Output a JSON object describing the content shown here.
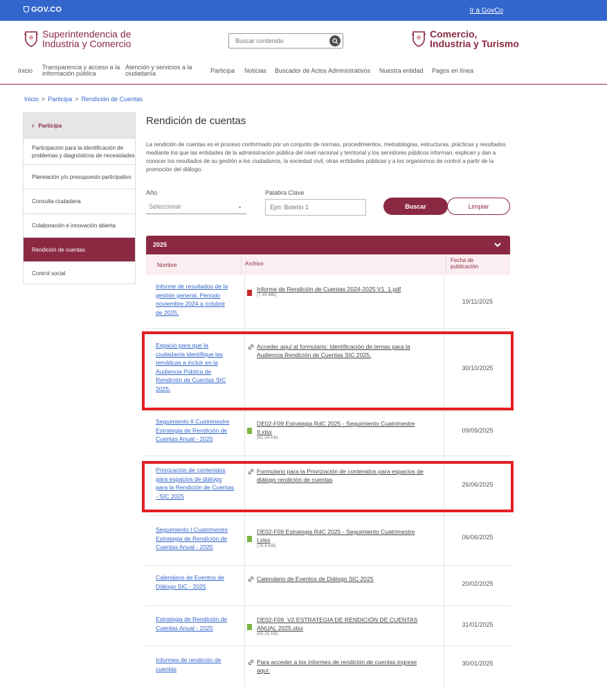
{
  "govbar": {
    "logo": "GOV.CO",
    "link": "Ir a GovCo"
  },
  "header": {
    "brand_left_line1": "Superintendencia de",
    "brand_left_line2": "Industria y Comercio",
    "search_placeholder": "Buscar contenido",
    "brand_right_line1": "Comercio,",
    "brand_right_line2": "Industria y Turismo"
  },
  "nav": {
    "items": [
      {
        "l1": "Inicio",
        "l2": ""
      },
      {
        "l1": "Transparencia y acceso a la",
        "l2": "información pública"
      },
      {
        "l1": "Atención y servicios a la",
        "l2": "ciudadanía"
      },
      {
        "l1": "Participa",
        "l2": ""
      },
      {
        "l1": "Noticias",
        "l2": ""
      },
      {
        "l1": "Buscador de Actos Administrativos",
        "l2": ""
      },
      {
        "l1": "Nuestra entidad",
        "l2": ""
      },
      {
        "l1": "Pagos en línea",
        "l2": ""
      }
    ]
  },
  "breadcrumb": {
    "b1": "Inicio",
    "b2": "Participa",
    "b3": "Rendición de Cuentas",
    "sep": ">"
  },
  "sidebar": {
    "header": "Participa",
    "items": [
      {
        "l1": "Participación para la identificación de",
        "l2": "problemas y diagnósticos de necesidades"
      },
      {
        "l1": "Planeación y/o presupuesto participativo",
        "l2": ""
      },
      {
        "l1": "Consulta ciudadana",
        "l2": ""
      },
      {
        "l1": "Colaboración e innovación abierta",
        "l2": ""
      },
      {
        "l1": "Rendición de cuentas",
        "l2": ""
      },
      {
        "l1": "Control social",
        "l2": ""
      }
    ]
  },
  "main": {
    "title": "Rendición de cuentas",
    "intro": "La rendición de cuentas es el proceso conformado por un conjunto de normas, procedimientos, metodologías, estructuras, prácticas y resultados mediante los que las entidades de la administración pública del nivel nacional y territorial y los servidores públicos informan, explican y dan a conocer los resultados de su gestión a los ciudadanos, la sociedad civil, otras entidades públicas y a los organismos de control a partir de la promoción del diálogo."
  },
  "filters": {
    "year_label": "Año",
    "year_value": "Seleccionar",
    "keyword_label": "Palabra Clave",
    "keyword_placeholder": "Ejm: Boletín 1",
    "search_button": "Buscar",
    "clear_button": "Limpiar"
  },
  "table": {
    "year": "2025",
    "col_name": "Nombre",
    "col_file": "Archivo",
    "col_date_l1": "Fecha de",
    "col_date_l2": "publicación",
    "rows": [
      {
        "name": [
          "Informe de resultados de la",
          "gestión general. Periodo",
          "noviembre 2024 a octubre",
          "de 2025."
        ],
        "file": [
          "Informe de Rendición de Cuentas 2024-2025 V1_1.pdf"
        ],
        "size": "(7.45 MB)",
        "icon": "pdf-icon",
        "date": "19/11/2025"
      },
      {
        "name": [
          "Espacio para que la",
          "ciudadanía identifique las",
          "temáticas a incluir en la",
          "Audiencia Pública de",
          "Rendición de Cuentas SIC",
          "2025."
        ],
        "file": [
          "Acceder aquí al formulario: Identificación de temas para la",
          "Audiencia Rendición de Cuentas SIC 2025."
        ],
        "size": "",
        "icon": "link-icon",
        "date": "30/10/2025"
      },
      {
        "name": [
          "Seguimiento II Cuatrimestre",
          "Estrategia de Rendición de",
          "Cuentas Anual - 2025"
        ],
        "file": [
          "DE02-F09 Estrategia RdC 2025 - Seguimiento Cuatrimestre",
          "II.xlsx"
        ],
        "size": "(82.04 KB)",
        "icon": "xlsx-icon",
        "date": "09/09/2025"
      },
      {
        "name": [
          "Priorización de contenidos",
          "para espacios de diálogo",
          "para la Rendición de Cuentas",
          "- SIC 2025"
        ],
        "file": [
          "Formulario para la Priorización de contenidos para espacios de",
          "diálogo rendición de cuentas"
        ],
        "size": "",
        "icon": "link-icon",
        "date": "26/06/2025"
      },
      {
        "name": [
          "Seguimiento I Cuatrimestre",
          "Estrategia de Rendición de",
          "Cuentas Anual - 2025"
        ],
        "file": [
          "DE02-F09 Estrategia RdC 2025 - Seguimiento Cuatrimestre",
          "I.xlsx"
        ],
        "size": "(76.4 KB)",
        "icon": "xlsx-icon",
        "date": "06/06/2025"
      },
      {
        "name": [
          "Calendario de Eventos de",
          "Diálogo SIC - 2025"
        ],
        "file": [
          "Calendario de Eventos de Diálogo SIC 2025"
        ],
        "size": "",
        "icon": "link-icon",
        "date": "20/02/2025"
      },
      {
        "name": [
          "Estrategia de Rendición de",
          "Cuentas Anual - 2025"
        ],
        "file": [
          "DE02-F09_V2 ESTRATEGIA DE RENDICIÓN DE CUENTAS",
          "ANUAL 2025.xlsx"
        ],
        "size": "(65.25 KB)",
        "icon": "xlsx-icon",
        "date": "31/01/2025"
      },
      {
        "name": [
          "Informes de rendición de",
          "cuentas"
        ],
        "file": [
          "Para acceder a los informes de rendición de cuentas ingrese",
          "aquí:"
        ],
        "size": "",
        "icon": "link-icon",
        "date": "30/01/2025"
      }
    ]
  },
  "colors": {
    "govbar": "#3366cc",
    "brand": "#8b2942",
    "link": "#3366cc",
    "highlight": "#e31e24"
  }
}
